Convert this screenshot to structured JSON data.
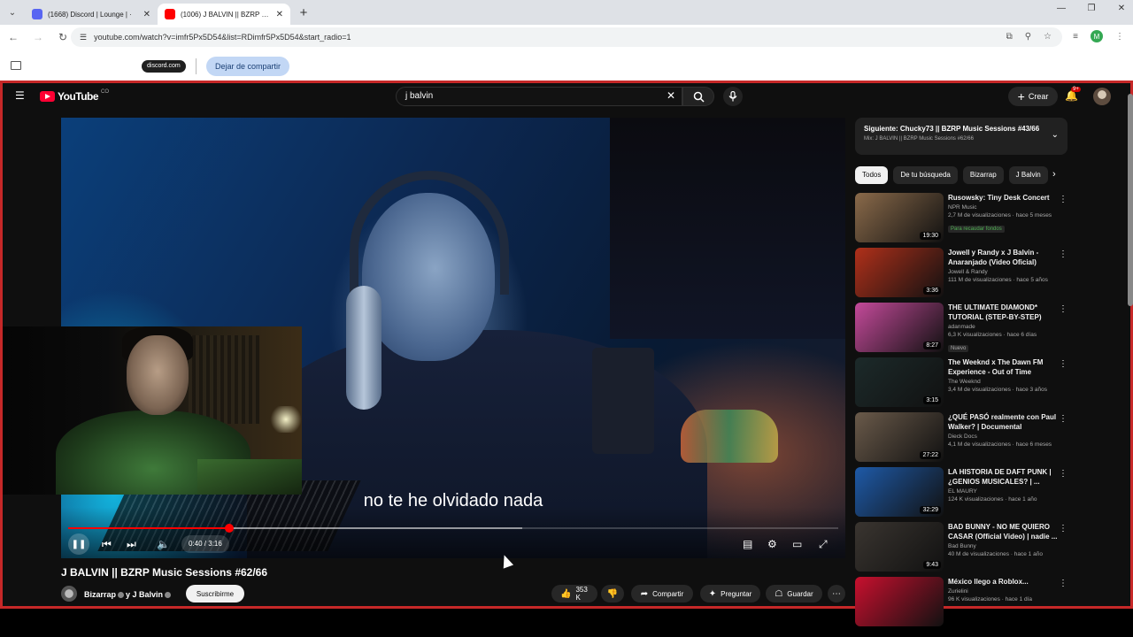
{
  "browser": {
    "tabs": [
      {
        "title": "(1668) Discord | Lounge | ·",
        "color": "#5865f2"
      },
      {
        "title": "(1006) J BALVIN || BZRP Mu",
        "color": "#ff0000"
      }
    ],
    "new_tab": "+",
    "url": "youtube.com/watch?v=imfr5Px5D54&list=RDimfr5Px5D54&start_radio=1",
    "profile_initial": "M",
    "share_domain": "discord.com",
    "share_stop": "Dejar de compartir"
  },
  "youtube": {
    "logo_text": "YouTube",
    "logo_region": "CO",
    "search_value": "j balvin",
    "create_label": "Crear",
    "notif_count": "9+",
    "player": {
      "subtitle": "no te he olvidado nada",
      "time": "0:40 / 3:16",
      "progress": 0.209,
      "buffered": 0.59
    },
    "video_title": "J BALVIN || BZRP Music Sessions #62/66",
    "channel": "Bizarrap",
    "channel_and": "y J Balvin",
    "subscribe": "Suscribirme",
    "actions": {
      "likes": "353 K",
      "share": "Compartir",
      "ask": "Preguntar",
      "save": "Guardar"
    },
    "up_next": {
      "title": "Siguiente: Chucky73 || BZRP Music Sessions #43/66",
      "subtitle": "Mix: J BALVIN || BZRP Music Sessions #62/66"
    },
    "chips": [
      "Todos",
      "De tu búsqueda",
      "Bizarrap",
      "J Balvin"
    ],
    "recommendations": [
      {
        "title": "Rusowsky: Tiny Desk Concert",
        "channel": "NPR Music",
        "meta": "2,7 M de visualizaciones · hace 5 meses",
        "badge": "Para recaudar fondos",
        "duration": "19:30",
        "thumb": "#8a6a4a"
      },
      {
        "title": "Jowell y Randy x J Balvin - Anaranjado (Video Oficial)",
        "channel": "Jowell & Randy",
        "meta": "111 M de visualizaciones · hace 5 años",
        "badge": "",
        "duration": "3:36",
        "thumb": "#b0301a"
      },
      {
        "title": "THE ULTIMATE DIAMOND* TUTORIAL (STEP-BY-STEP)",
        "channel": "adanmade",
        "meta": "6,3 K visualizaciones · hace 6 días",
        "badge": "Nuevo",
        "duration": "8:27",
        "thumb": "#c44a9a"
      },
      {
        "title": "The Weeknd x The Dawn FM Experience - Out of Time",
        "channel": "The Weeknd",
        "meta": "3,4 M de visualizaciones · hace 3 años",
        "badge": "",
        "duration": "3:15",
        "thumb": "#1c2a2a"
      },
      {
        "title": "¿QUÉ PASÓ realmente con Paul Walker? | Documental",
        "channel": "Dieck Docs",
        "meta": "4,1 M de visualizaciones · hace 6 meses",
        "badge": "",
        "duration": "27:22",
        "thumb": "#6a5a4a"
      },
      {
        "title": "LA HISTORIA DE DAFT PUNK | ¿GENIOS MUSICALES? | ...",
        "channel": "EL MAURY",
        "meta": "124 K visualizaciones · hace 1 año",
        "badge": "",
        "duration": "32:29",
        "thumb": "#1e5aa8"
      },
      {
        "title": "BAD BUNNY - NO ME QUIERO CASAR (Official Video) | nadie ...",
        "channel": "Bad Bunny",
        "meta": "40 M de visualizaciones · hace 1 año",
        "badge": "",
        "duration": "9:43",
        "thumb": "#3a3530"
      },
      {
        "title": "México llego a Roblox...",
        "channel": "Zurielini",
        "meta": "96 K visualizaciones · hace 1 día",
        "badge": "",
        "duration": "",
        "thumb": "#c8102e"
      }
    ]
  },
  "colors": {
    "accent": "#ff0000",
    "share_border": "#c62828",
    "bg": "#0f0f0f"
  }
}
